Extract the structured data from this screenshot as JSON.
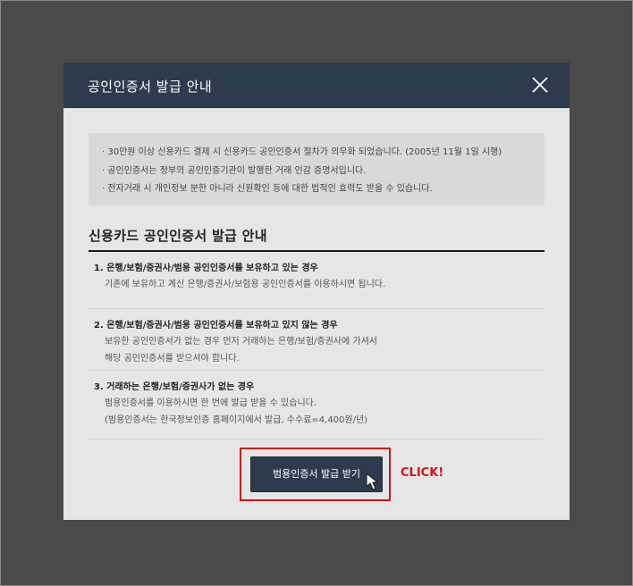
{
  "modal": {
    "title": "공인인증서 발급 안내",
    "close_icon": "close-icon"
  },
  "notice": {
    "lines": [
      "· 30만원 이상 신용카드 결제 시 신용카드 공인인증서 절차가 의무화 되었습니다. (2005년 11월 1일 시행)",
      "· 공인인증서는 정부의 공인인증기관이 발행한 거래 인감 증명서입니다.",
      "· 전자거래 시 개인정보 분한 아니라 신원확인 등에 대한 법적인 효력도 받을 수 있습니다."
    ]
  },
  "section": {
    "title": "신용카드 공인인증서 발급 안내"
  },
  "guide": {
    "items": [
      {
        "heading": "1. 은행/보험/증권사/범용 공인인증서를 보유하고 있는 경우",
        "desc": [
          "기존에 보유하고 계신 은행/증권사/보험용 공인인증서를 이용하시면 됩니다."
        ]
      },
      {
        "heading": "2. 은행/보험/증권사/범용 공인인증서를 보유하고 있지 않는 경우",
        "desc": [
          "보유한 공인인증서가 없는 경우 먼저 거래하는 은행/보험/증권사에 가셔서",
          "해당 공인인증서를 받으셔야 합니다."
        ]
      },
      {
        "heading": "3. 거래하는 은행/보험/증권사가 없는 경우",
        "desc": [
          "범용인증서를 이용하시면 한 번에 발급 받을 수 있습니다.",
          "(범용인증서는 한국정보인증 홈페이지에서 발급, 수수료=4,400원/년)"
        ]
      }
    ]
  },
  "action": {
    "button_label": "범용인증서 발급 받기",
    "click_label": "CLICK!",
    "cursor_icon": "hand-pointer-icon",
    "highlight_color": "#d0141b"
  },
  "colors": {
    "header_bg": "#2e3b4e",
    "modal_bg": "#e6e6e6",
    "backdrop": "#4a4a4a"
  }
}
